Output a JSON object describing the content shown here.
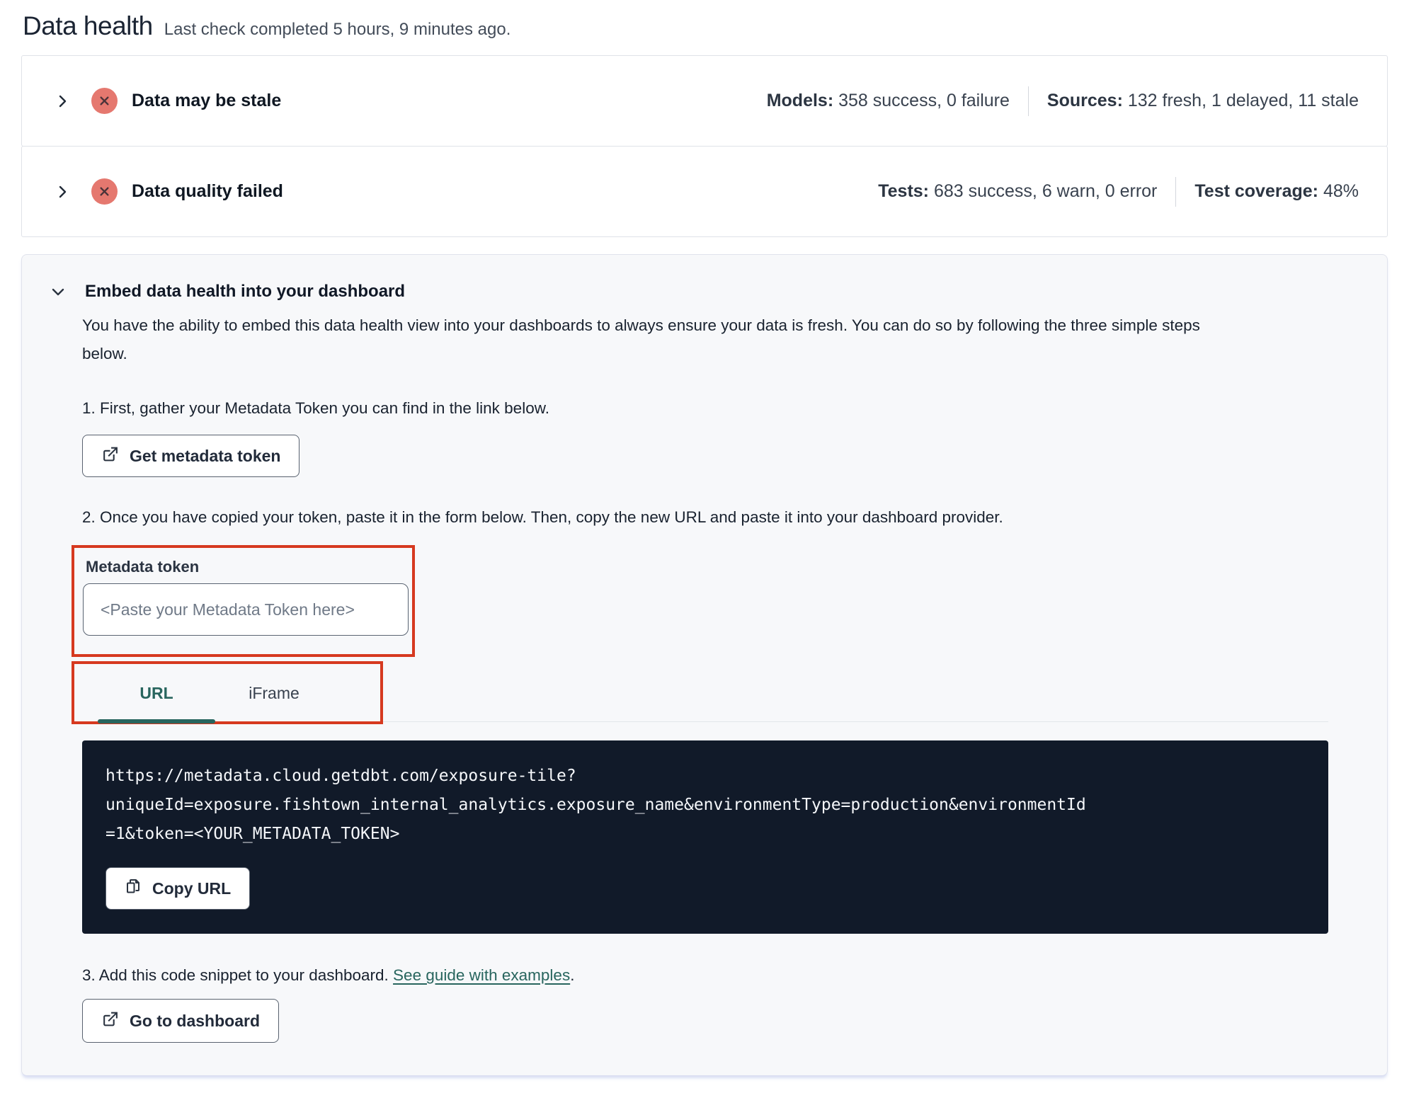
{
  "page": {
    "title": "Data health",
    "subtitle": "Last check completed 5 hours, 9 minutes ago."
  },
  "status_panels": [
    {
      "title": "Data may be stale",
      "stats": [
        {
          "label": "Models:",
          "value": "358 success, 0 failure"
        },
        {
          "label": "Sources:",
          "value": "132 fresh, 1 delayed, 11 stale"
        }
      ]
    },
    {
      "title": "Data quality failed",
      "stats": [
        {
          "label": "Tests:",
          "value": "683 success, 6 warn, 0 error"
        },
        {
          "label": "Test coverage:",
          "value": "48%"
        }
      ]
    }
  ],
  "embed": {
    "title": "Embed data health into your dashboard",
    "description": "You have the ability to embed this data health view into your dashboards to always ensure your data is fresh. You can do so by following the three simple steps below.",
    "step1": "1. First, gather your Metadata Token you can find in the link below.",
    "get_token_button": "Get metadata token",
    "step2": "2. Once you have copied your token, paste it in the form below. Then, copy the new URL and paste it into your dashboard provider.",
    "token_field": {
      "label": "Metadata token",
      "value": "",
      "placeholder": "<Paste your Metadata Token here>"
    },
    "tabs": [
      {
        "label": "URL",
        "active": true
      },
      {
        "label": "iFrame",
        "active": false
      }
    ],
    "code": {
      "url": "https://metadata.cloud.getdbt.com/exposure-tile?uniqueId=exposure.fishtown_internal_analytics.exposure_name&environmentType=production&environmentId=1&token=<YOUR_METADATA_TOKEN>",
      "url_lines": [
        "https://metadata.cloud.getdbt.com/exposure-tile?",
        "uniqueId=exposure.fishtown_internal_analytics.exposure_name&environmentType=production&environmentId",
        "=1&token=<YOUR_METADATA_TOKEN>"
      ],
      "copy_button": "Copy URL"
    },
    "step3_prefix": "3. Add this code snippet to your dashboard. ",
    "step3_link": "See guide with examples",
    "step3_suffix": ".",
    "dashboard_button": "Go to dashboard"
  },
  "colors": {
    "error_badge_bg": "#e5786f",
    "error_badge_x": "#4a3339",
    "accent_teal": "#28655e",
    "annotation_red": "#d6391f",
    "code_bg": "#111a29"
  }
}
